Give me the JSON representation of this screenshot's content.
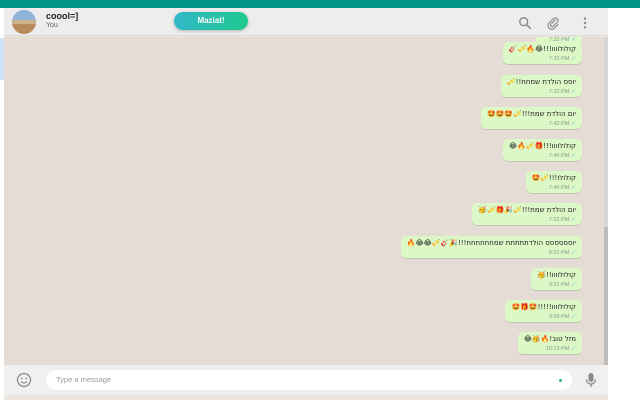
{
  "header": {
    "contact_name": "coool=]",
    "contact_sub": "You",
    "action_button": "Maziat!"
  },
  "messages": [
    {
      "text": "",
      "time": "7:32 PM"
    },
    {
      "text": "קולולוווו!!!😂🔥🎺🎸",
      "time": "7:32 PM"
    },
    {
      "text": "יוסס הולדת שמחח!!🎺",
      "time": "7:32 PM"
    },
    {
      "text": "יום הולדת שמח!!!🎺🤩🤩🤩",
      "time": "7:42 PM"
    },
    {
      "text": "קולולוווו!!!🎁🎺🔥😂",
      "time": "7:46 PM"
    },
    {
      "text": "קולולו!!!🎺🤩",
      "time": "7:46 PM"
    },
    {
      "text": "יום הולדת שמח!!!🎺🎉🎁🎺🥳",
      "time": "7:52 PM"
    },
    {
      "text": "יוסססססס הולדתתתתת שמחחחחחח!!!🎉🎸🎺😂😂🔥",
      "time": "8:01 PM"
    },
    {
      "text": "קולולוווו!!🥳",
      "time": "9:31 PM"
    },
    {
      "text": "קולולוווו!!!!!🤩🎁🤩",
      "time": "9:58 PM"
    },
    {
      "text": "מזל טוב!🔥🥳😂",
      "time": "10:13 PM"
    }
  ],
  "composer": {
    "placeholder": "Type a message"
  },
  "icons": {
    "search": "search-icon",
    "attach": "paperclip-icon",
    "menu": "kebab-menu-icon",
    "emoji": "emoji-icon",
    "mic": "microphone-icon"
  },
  "colors": {
    "accent": "#009688",
    "bubble": "#dcf8c6",
    "chat_bg": "#e5ddd5"
  }
}
